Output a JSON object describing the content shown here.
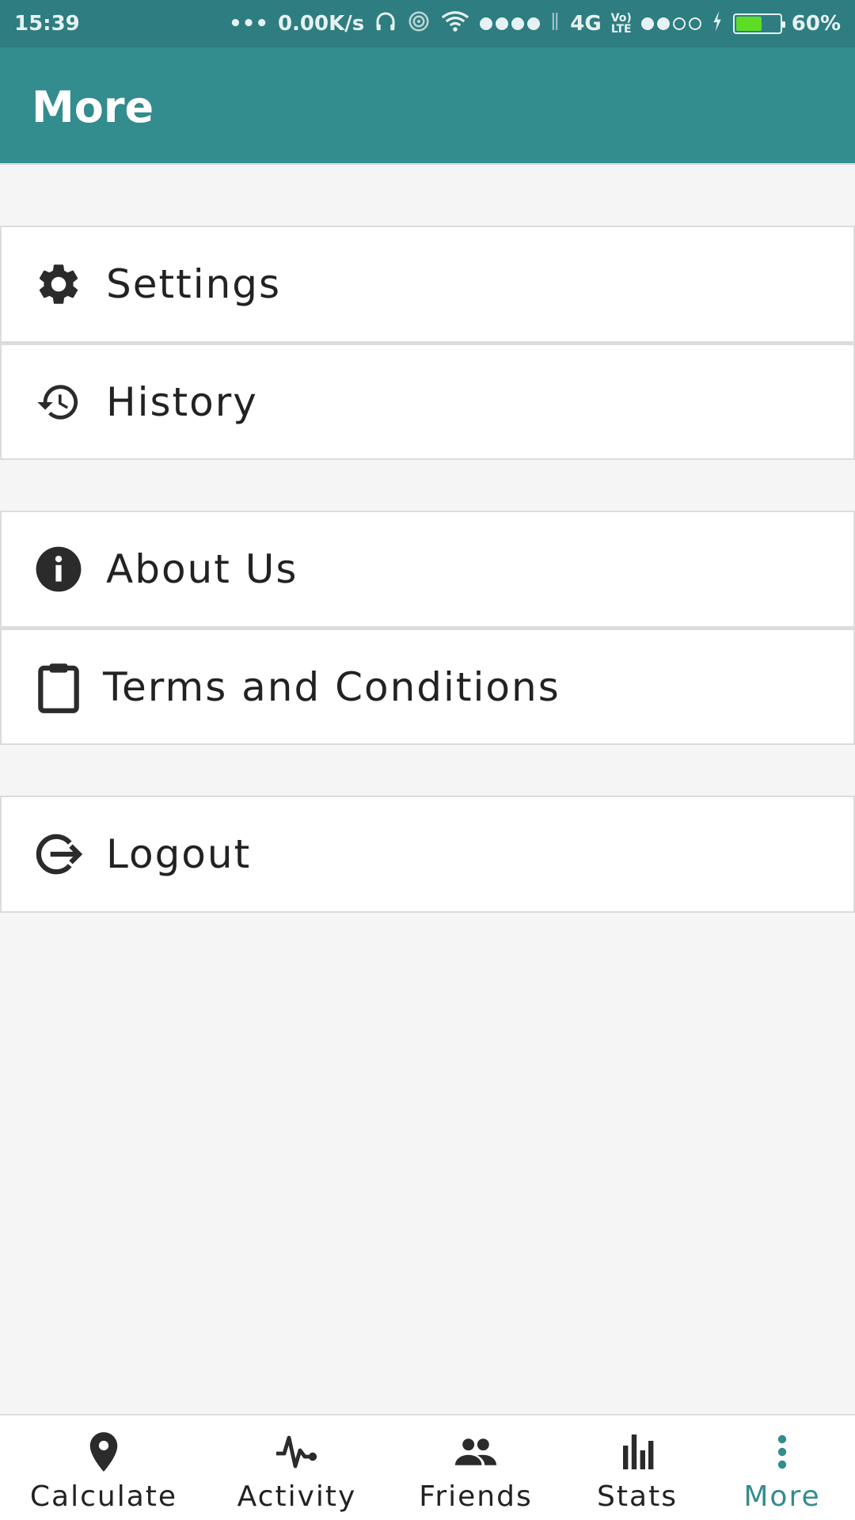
{
  "status_bar": {
    "time": "15:39",
    "more": "•••",
    "speed": "0.00K/s",
    "network": "4G",
    "volte_top": "Vo)",
    "volte_bottom": "LTE",
    "battery_percent": "60%",
    "battery_level": 0.6,
    "signal1_bars": 4,
    "signal2_bars": 2
  },
  "appbar": {
    "title": "More"
  },
  "menu": {
    "settings": {
      "label": "Settings",
      "icon": "gear-icon"
    },
    "history": {
      "label": "History",
      "icon": "history-icon"
    },
    "about": {
      "label": "About Us",
      "icon": "info-icon"
    },
    "terms": {
      "label": "Terms and Conditions",
      "icon": "clipboard-icon"
    },
    "logout": {
      "label": "Logout",
      "icon": "logout-icon"
    }
  },
  "bottom_nav": {
    "active": "More",
    "tabs": [
      {
        "label": "Calculate",
        "icon": "location-pin-icon"
      },
      {
        "label": "Activity",
        "icon": "pulse-icon"
      },
      {
        "label": "Friends",
        "icon": "people-icon"
      },
      {
        "label": "Stats",
        "icon": "bar-chart-icon"
      },
      {
        "label": "More",
        "icon": "more-vert-icon"
      }
    ]
  },
  "colors": {
    "primary": "#338c8e",
    "status_bar": "#2e7d80",
    "text": "#222222",
    "background": "#f5f5f5",
    "battery": "#5ddc26"
  }
}
